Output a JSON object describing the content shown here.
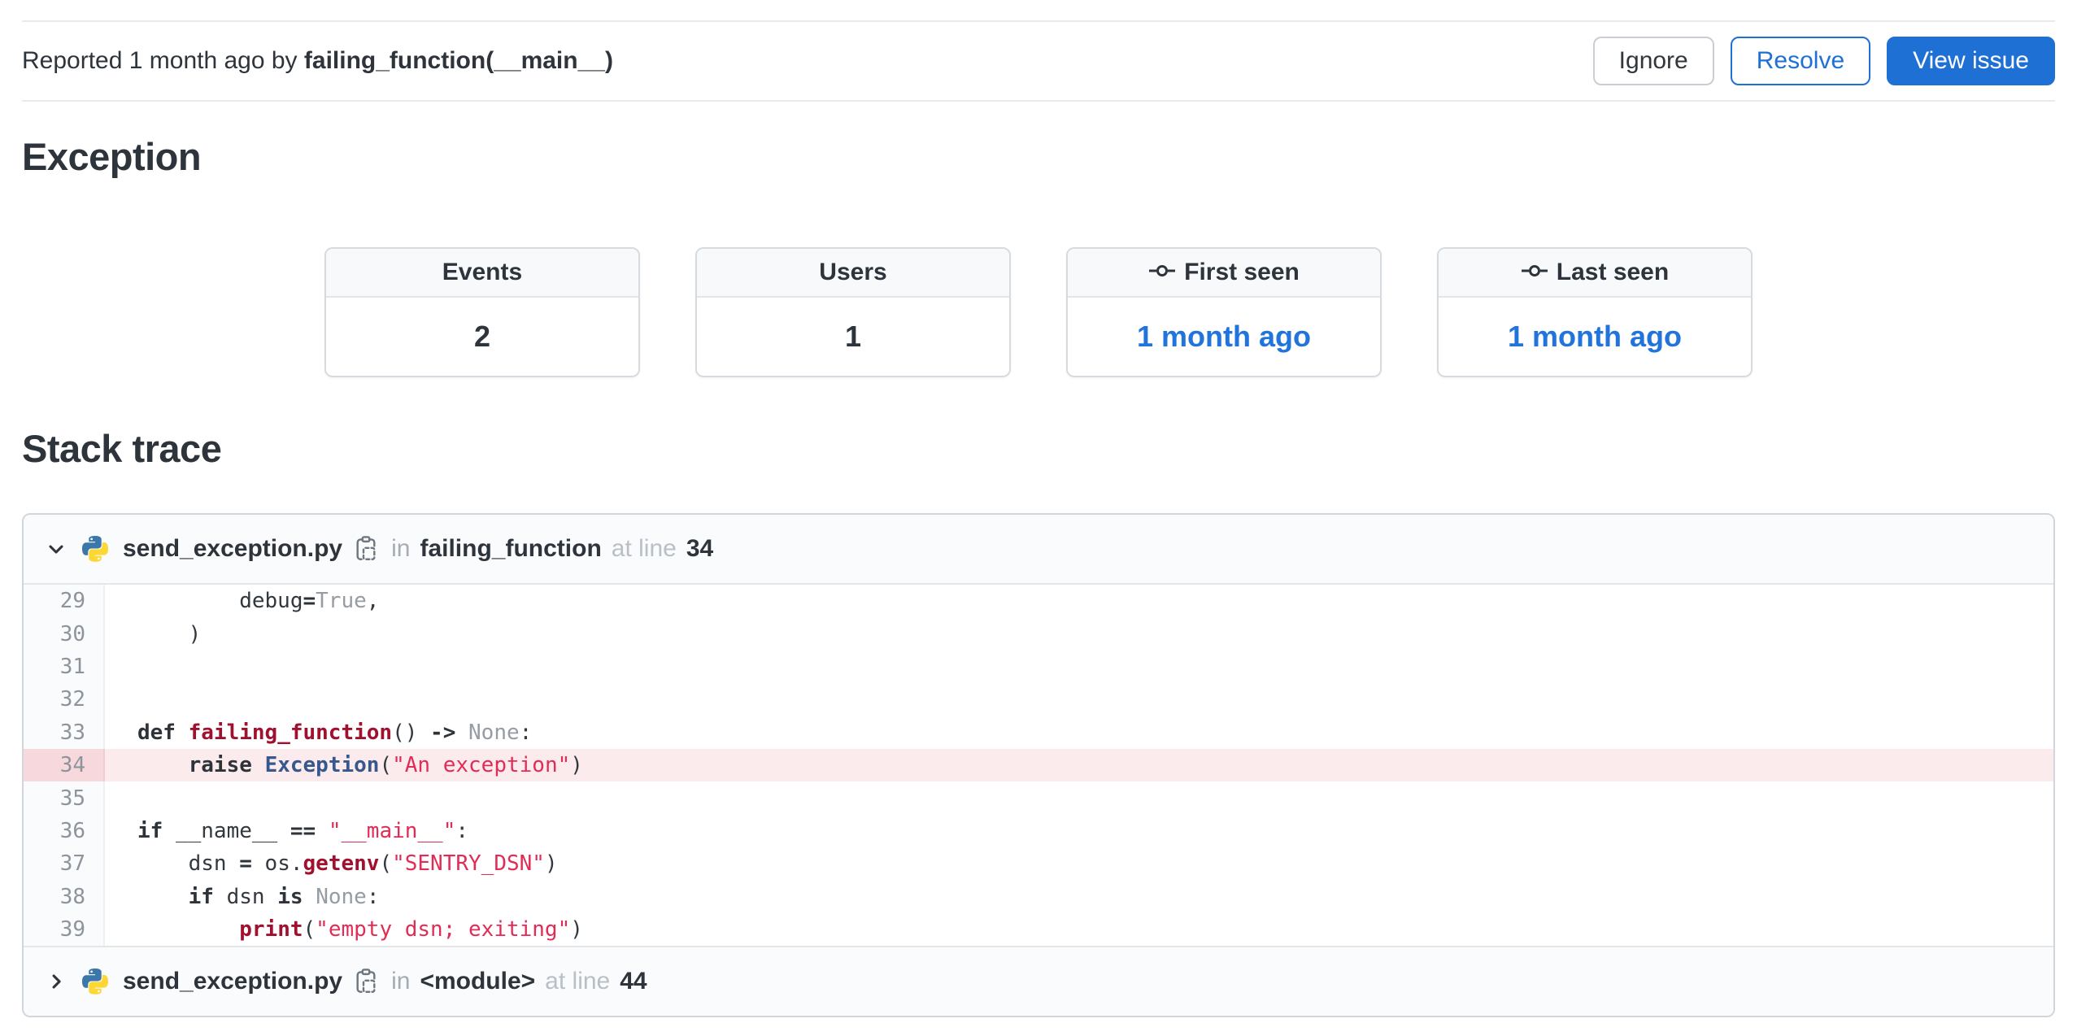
{
  "colors": {
    "accent_blue": "#1f70d4",
    "link_blue": "#2274dd",
    "highlight_row": "#fcebed",
    "highlight_gutter": "#f7d9dd",
    "syntax_function": "#a0112f",
    "syntax_class": "#36588f",
    "syntax_string": "#e12d56",
    "syntax_constant": "#969ca4",
    "code_base": "#32383f"
  },
  "toolbar": {
    "reported_prefix": "Reported 1 month ago by ",
    "reported_by": "failing_function(__main__)",
    "buttons": [
      {
        "name": "ignore-button",
        "label": "Ignore",
        "variant": "default"
      },
      {
        "name": "resolve-button",
        "label": "Resolve",
        "variant": "outline"
      },
      {
        "name": "view-issue-button",
        "label": "View issue",
        "variant": "primary"
      }
    ]
  },
  "exception": {
    "title": "Exception",
    "stats": [
      {
        "name": "events",
        "label": "Events",
        "value": "2",
        "link": false,
        "icon": null
      },
      {
        "name": "users",
        "label": "Users",
        "value": "1",
        "link": false,
        "icon": null
      },
      {
        "name": "first-seen",
        "label": "First seen",
        "value": "1 month ago",
        "link": true,
        "icon": "commit-icon"
      },
      {
        "name": "last-seen",
        "label": "Last seen",
        "value": "1 month ago",
        "link": true,
        "icon": "commit-icon"
      }
    ]
  },
  "stack_trace": {
    "title": "Stack trace",
    "frames": [
      {
        "expanded": true,
        "file_icon": "python-icon",
        "filename": "send_exception.py",
        "copy_icon": "copy-icon",
        "in_label": "in",
        "function": "failing_function",
        "at_label": "at line",
        "line": "34",
        "code": [
          {
            "n": "29",
            "hl": false,
            "tokens": [
              [
                "p",
                "        debug"
              ],
              [
                "k",
                "="
              ],
              [
                "c",
                "True"
              ],
              [
                "p",
                ","
              ]
            ]
          },
          {
            "n": "30",
            "hl": false,
            "tokens": [
              [
                "p",
                "    )"
              ]
            ]
          },
          {
            "n": "31",
            "hl": false,
            "tokens": []
          },
          {
            "n": "32",
            "hl": false,
            "tokens": []
          },
          {
            "n": "33",
            "hl": false,
            "tokens": [
              [
                "k",
                "def"
              ],
              [
                "p",
                " "
              ],
              [
                "f",
                "failing_function"
              ],
              [
                "p",
                "() "
              ],
              [
                "k",
                "->"
              ],
              [
                "p",
                " "
              ],
              [
                "c",
                "None"
              ],
              [
                "p",
                ":"
              ]
            ]
          },
          {
            "n": "34",
            "hl": true,
            "tokens": [
              [
                "p",
                "    "
              ],
              [
                "k",
                "raise"
              ],
              [
                "p",
                " "
              ],
              [
                "cl",
                "Exception"
              ],
              [
                "p",
                "("
              ],
              [
                "s",
                "\"An exception\""
              ],
              [
                "p",
                ")"
              ]
            ]
          },
          {
            "n": "35",
            "hl": false,
            "tokens": []
          },
          {
            "n": "36",
            "hl": false,
            "tokens": [
              [
                "k",
                "if"
              ],
              [
                "p",
                " __name__ "
              ],
              [
                "k",
                "=="
              ],
              [
                "p",
                " "
              ],
              [
                "s",
                "\"__main__\""
              ],
              [
                "p",
                ":"
              ]
            ]
          },
          {
            "n": "37",
            "hl": false,
            "tokens": [
              [
                "p",
                "    dsn "
              ],
              [
                "k",
                "="
              ],
              [
                "p",
                " os."
              ],
              [
                "f",
                "getenv"
              ],
              [
                "p",
                "("
              ],
              [
                "s",
                "\"SENTRY_DSN\""
              ],
              [
                "p",
                ")"
              ]
            ]
          },
          {
            "n": "38",
            "hl": false,
            "tokens": [
              [
                "p",
                "    "
              ],
              [
                "k",
                "if"
              ],
              [
                "p",
                " dsn "
              ],
              [
                "k",
                "is"
              ],
              [
                "p",
                " "
              ],
              [
                "c",
                "None"
              ],
              [
                "p",
                ":"
              ]
            ]
          },
          {
            "n": "39",
            "hl": false,
            "tokens": [
              [
                "p",
                "        "
              ],
              [
                "f",
                "print"
              ],
              [
                "p",
                "("
              ],
              [
                "s",
                "\"empty dsn; exiting\""
              ],
              [
                "p",
                ")"
              ]
            ]
          }
        ]
      },
      {
        "expanded": false,
        "file_icon": "python-icon",
        "filename": "send_exception.py",
        "copy_icon": "copy-icon",
        "in_label": "in",
        "function": "<module>",
        "at_label": "at line",
        "line": "44",
        "code": []
      }
    ]
  }
}
